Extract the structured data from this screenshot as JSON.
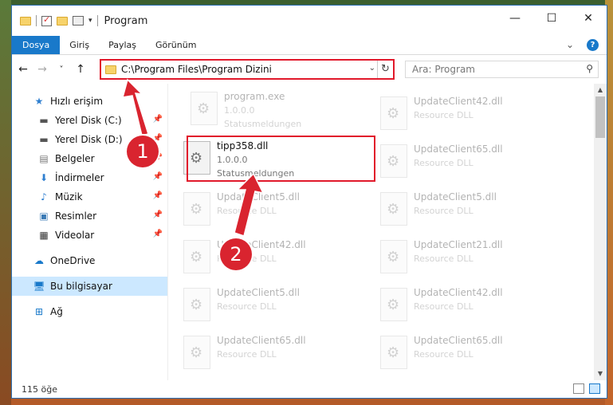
{
  "window": {
    "title": "Program",
    "controls": {
      "minimize": "—",
      "maximize": "☐",
      "close": "✕"
    }
  },
  "ribbon": {
    "tabs": [
      "Dosya",
      "Giriş",
      "Paylaş",
      "Görünüm"
    ],
    "expand_icon": "chevron-down-icon",
    "help_label": "?"
  },
  "nav": {
    "back": "←",
    "forward": "→",
    "recent": "˅",
    "up": "↑",
    "address": "C:\\Program Files\\Program Dizini",
    "search_placeholder": "Ara: Program"
  },
  "sidebar": {
    "items": [
      {
        "label": "Hızlı erişim",
        "icon": "star-icon",
        "pinned": false
      },
      {
        "label": "Yerel Disk (C:)",
        "icon": "drive-icon",
        "pinned": true
      },
      {
        "label": "Yerel Disk (D:)",
        "icon": "drive-icon",
        "pinned": true
      },
      {
        "label": "Belgeler",
        "icon": "documents-icon",
        "pinned": true
      },
      {
        "label": "İndirmeler",
        "icon": "downloads-icon",
        "pinned": true
      },
      {
        "label": "Müzik",
        "icon": "music-icon",
        "pinned": true
      },
      {
        "label": "Resimler",
        "icon": "pictures-icon",
        "pinned": true
      },
      {
        "label": "Videolar",
        "icon": "videos-icon",
        "pinned": true
      },
      {
        "label": "OneDrive",
        "icon": "cloud-icon",
        "pinned": false
      },
      {
        "label": "Bu bilgisayar",
        "icon": "computer-icon",
        "pinned": false,
        "selected": true
      },
      {
        "label": "Ağ",
        "icon": "network-icon",
        "pinned": false
      }
    ]
  },
  "files": [
    {
      "name": "program.exe",
      "version": "1.0.0.0",
      "description": "Statusmeldungen",
      "faded": true
    },
    {
      "name": "UpdateClient42.dll",
      "version": "",
      "description": "Resource DLL",
      "faded": true
    },
    {
      "name": "tipp358.dll",
      "version": "1.0.0.0",
      "description": "Statusmeldungen",
      "faded": false,
      "highlighted": true
    },
    {
      "name": "UpdateClient65.dll",
      "version": "",
      "description": "Resource DLL",
      "faded": true
    },
    {
      "name": "UpdateClient5.dll",
      "version": "",
      "description": "Resource DLL",
      "faded": true
    },
    {
      "name": "UpdateClient5.dll",
      "version": "",
      "description": "Resource DLL",
      "faded": true
    },
    {
      "name": "UpdateClient42.dll",
      "version": "",
      "description": "Resource DLL",
      "faded": true
    },
    {
      "name": "UpdateClient21.dll",
      "version": "",
      "description": "Resource DLL",
      "faded": true
    },
    {
      "name": "UpdateClient5.dll",
      "version": "",
      "description": "Resource DLL",
      "faded": true
    },
    {
      "name": "UpdateClient42.dll",
      "version": "",
      "description": "Resource DLL",
      "faded": true
    },
    {
      "name": "UpdateClient65.dll",
      "version": "",
      "description": "Resource DLL",
      "faded": true
    },
    {
      "name": "UpdateClient65.dll",
      "version": "",
      "description": "Resource DLL",
      "faded": true
    }
  ],
  "status": {
    "item_count": "115 öğe"
  },
  "annotations": {
    "step1": "1",
    "step2": "2",
    "color": "#d9242f"
  }
}
